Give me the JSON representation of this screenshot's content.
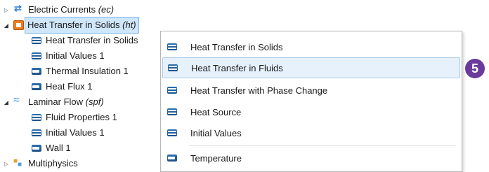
{
  "tree": {
    "items": [
      {
        "label": "Electric Currents",
        "tag": "(ec)"
      },
      {
        "label": "Heat Transfer in Solids",
        "tag": "(ht)"
      },
      {
        "label": "Heat Transfer in Solids"
      },
      {
        "label": "Initial Values 1"
      },
      {
        "label": "Thermal Insulation 1"
      },
      {
        "label": "Heat Flux 1"
      },
      {
        "label": "Laminar Flow",
        "tag": "(spf)"
      },
      {
        "label": "Fluid Properties 1"
      },
      {
        "label": "Initial Values 1"
      },
      {
        "label": "Wall 1"
      },
      {
        "label": "Multiphysics"
      }
    ]
  },
  "menu": {
    "items": [
      {
        "label": "Heat Transfer in Solids"
      },
      {
        "label": "Heat Transfer in Fluids"
      },
      {
        "label": "Heat Transfer with Phase Change"
      },
      {
        "label": "Heat Source"
      },
      {
        "label": "Initial Values"
      },
      {
        "label": "Temperature"
      }
    ]
  },
  "badge": {
    "text": "5",
    "color": "#6a3b9b"
  },
  "colors": {
    "selection": "#cfe6fb",
    "hover": "#e6f1fb",
    "node_icon": "#1b4f86"
  }
}
